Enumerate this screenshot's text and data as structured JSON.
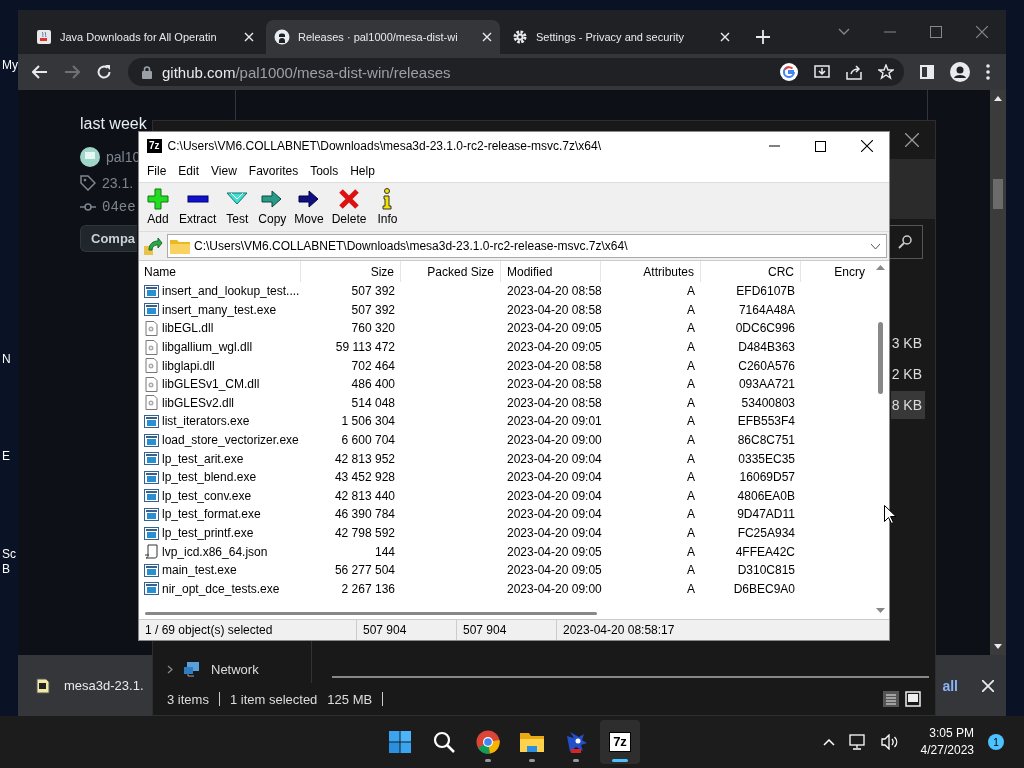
{
  "desktop": {
    "icon_labels": [
      "My",
      "N",
      "E",
      "Sc",
      "B"
    ]
  },
  "browser": {
    "tabs": [
      {
        "title": "Java Downloads for All Operatin",
        "kind": "java",
        "selected": false
      },
      {
        "title": "Releases · pal1000/mesa-dist-wi",
        "kind": "github",
        "selected": true
      },
      {
        "title": "Settings - Privacy and security",
        "kind": "gear",
        "selected": false
      }
    ],
    "forward_disabled": true,
    "url": {
      "host": "github.com",
      "path": "/pal1000/mesa-dist-win/releases"
    },
    "page": {
      "time": "last week",
      "author": "pal10",
      "tag": "23.1.",
      "commit": "04ee",
      "compare_button": "Compa"
    },
    "downloads_bar": {
      "file": "mesa3d-23.1.",
      "show_all": "all"
    }
  },
  "explorer": {
    "rows": [
      {
        "size": "3 KB",
        "selected": false
      },
      {
        "size": "2 KB",
        "selected": false
      },
      {
        "size": "8 KB",
        "selected": true
      }
    ],
    "nav": [
      {
        "label": "Network"
      }
    ],
    "status": {
      "count": "3 items",
      "selection": "1 item selected",
      "size": "125 MB"
    }
  },
  "sevenzip": {
    "title": "C:\\Users\\VM6.COLLABNET\\Downloads\\mesa3d-23.1.0-rc2-release-msvc.7z\\x64\\",
    "app_icon_text": "7z",
    "menu": [
      "File",
      "Edit",
      "View",
      "Favorites",
      "Tools",
      "Help"
    ],
    "toolbar": [
      {
        "label": "Add",
        "kind": "add"
      },
      {
        "label": "Extract",
        "kind": "extract"
      },
      {
        "label": "Test",
        "kind": "test"
      },
      {
        "label": "Copy",
        "kind": "copy"
      },
      {
        "label": "Move",
        "kind": "move"
      },
      {
        "label": "Delete",
        "kind": "delete"
      },
      {
        "label": "Info",
        "kind": "info"
      }
    ],
    "path": "C:\\Users\\VM6.COLLABNET\\Downloads\\mesa3d-23.1.0-rc2-release-msvc.7z\\x64\\",
    "columns": [
      "Name",
      "Size",
      "Packed Size",
      "Modified",
      "Attributes",
      "CRC",
      "Encry"
    ],
    "rows": [
      {
        "kind": "exe",
        "name": "insert_and_lookup_test....",
        "size": "507 392",
        "modified": "2023-04-20 08:58",
        "attributes": "A",
        "crc": "EFD6107B"
      },
      {
        "kind": "exe",
        "name": "insert_many_test.exe",
        "size": "507 392",
        "modified": "2023-04-20 08:58",
        "attributes": "A",
        "crc": "7164A48A"
      },
      {
        "kind": "dll",
        "name": "libEGL.dll",
        "size": "760 320",
        "modified": "2023-04-20 09:05",
        "attributes": "A",
        "crc": "0DC6C996"
      },
      {
        "kind": "dll",
        "name": "libgallium_wgl.dll",
        "size": "59 113 472",
        "modified": "2023-04-20 09:05",
        "attributes": "A",
        "crc": "D484B363"
      },
      {
        "kind": "dll",
        "name": "libglapi.dll",
        "size": "702 464",
        "modified": "2023-04-20 08:58",
        "attributes": "A",
        "crc": "C260A576"
      },
      {
        "kind": "dll",
        "name": "libGLESv1_CM.dll",
        "size": "486 400",
        "modified": "2023-04-20 08:58",
        "attributes": "A",
        "crc": "093AA721"
      },
      {
        "kind": "dll",
        "name": "libGLESv2.dll",
        "size": "514 048",
        "modified": "2023-04-20 08:58",
        "attributes": "A",
        "crc": "53400803"
      },
      {
        "kind": "exe",
        "name": "list_iterators.exe",
        "size": "1 506 304",
        "modified": "2023-04-20 09:01",
        "attributes": "A",
        "crc": "EFB553F4"
      },
      {
        "kind": "exe",
        "name": "load_store_vectorizer.exe",
        "size": "6 600 704",
        "modified": "2023-04-20 09:00",
        "attributes": "A",
        "crc": "86C8C751"
      },
      {
        "kind": "exe",
        "name": "lp_test_arit.exe",
        "size": "42 813 952",
        "modified": "2023-04-20 09:04",
        "attributes": "A",
        "crc": "0335EC35"
      },
      {
        "kind": "exe",
        "name": "lp_test_blend.exe",
        "size": "43 452 928",
        "modified": "2023-04-20 09:04",
        "attributes": "A",
        "crc": "16069D57"
      },
      {
        "kind": "exe",
        "name": "lp_test_conv.exe",
        "size": "42 813 440",
        "modified": "2023-04-20 09:04",
        "attributes": "A",
        "crc": "4806EA0B"
      },
      {
        "kind": "exe",
        "name": "lp_test_format.exe",
        "size": "46 390 784",
        "modified": "2023-04-20 09:04",
        "attributes": "A",
        "crc": "9D47AD11"
      },
      {
        "kind": "exe",
        "name": "lp_test_printf.exe",
        "size": "42 798 592",
        "modified": "2023-04-20 09:04",
        "attributes": "A",
        "crc": "FC25A934"
      },
      {
        "kind": "json",
        "name": "lvp_icd.x86_64.json",
        "size": "144",
        "modified": "2023-04-20 09:05",
        "attributes": "A",
        "crc": "4FFEA42C"
      },
      {
        "kind": "exe",
        "name": "main_test.exe",
        "size": "56 277 504",
        "modified": "2023-04-20 09:05",
        "attributes": "A",
        "crc": "D310C815"
      },
      {
        "kind": "exe",
        "name": "nir_opt_dce_tests.exe",
        "size": "2 267 136",
        "modified": "2023-04-20 09:00",
        "attributes": "A",
        "crc": "D6BEC9A0"
      }
    ],
    "status": [
      "1 / 69 object(s) selected",
      "507 904",
      "507 904",
      "2023-04-20 08:58:17"
    ]
  },
  "taskbar": {
    "apps": [
      {
        "kind": "start",
        "active": false
      },
      {
        "kind": "search",
        "active": false
      },
      {
        "kind": "chrome",
        "active": false
      },
      {
        "kind": "explorer",
        "active": false
      },
      {
        "kind": "game",
        "active": false
      },
      {
        "kind": "sevenzip",
        "label": "7z",
        "active": true
      }
    ],
    "time": "3:05 PM",
    "date": "4/27/2023",
    "notification_count": "1"
  }
}
